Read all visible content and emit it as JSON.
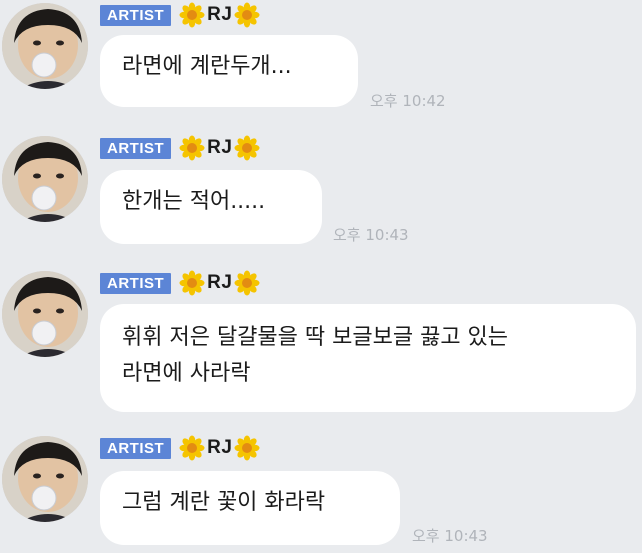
{
  "messages": [
    {
      "badge": "ARTIST",
      "name": "RJ",
      "text_lines": [
        "라면에 계란두개..."
      ],
      "time": "오후 10:42"
    },
    {
      "badge": "ARTIST",
      "name": "RJ",
      "text_lines": [
        "한개는 적어....."
      ],
      "time": "오후 10:43"
    },
    {
      "badge": "ARTIST",
      "name": "RJ",
      "text_lines": [
        "휘휘 저은 달걀물을 딱 보글보글 끓고 있는",
        "라면에 사라락"
      ],
      "time": ""
    },
    {
      "badge": "ARTIST",
      "name": "RJ",
      "text_lines": [
        "그럼 계란 꽃이 화라락"
      ],
      "time": "오후 10:43"
    }
  ],
  "colors": {
    "background": "#e9ebee",
    "badge": "#5c85d6",
    "bubble": "#ffffff",
    "time": "#b0b4ba",
    "flower_petal": "#f5c400",
    "flower_center": "#e38c12"
  },
  "icons": {
    "nickname_decoration": "flower-icon",
    "avatar": "avatar-image"
  }
}
